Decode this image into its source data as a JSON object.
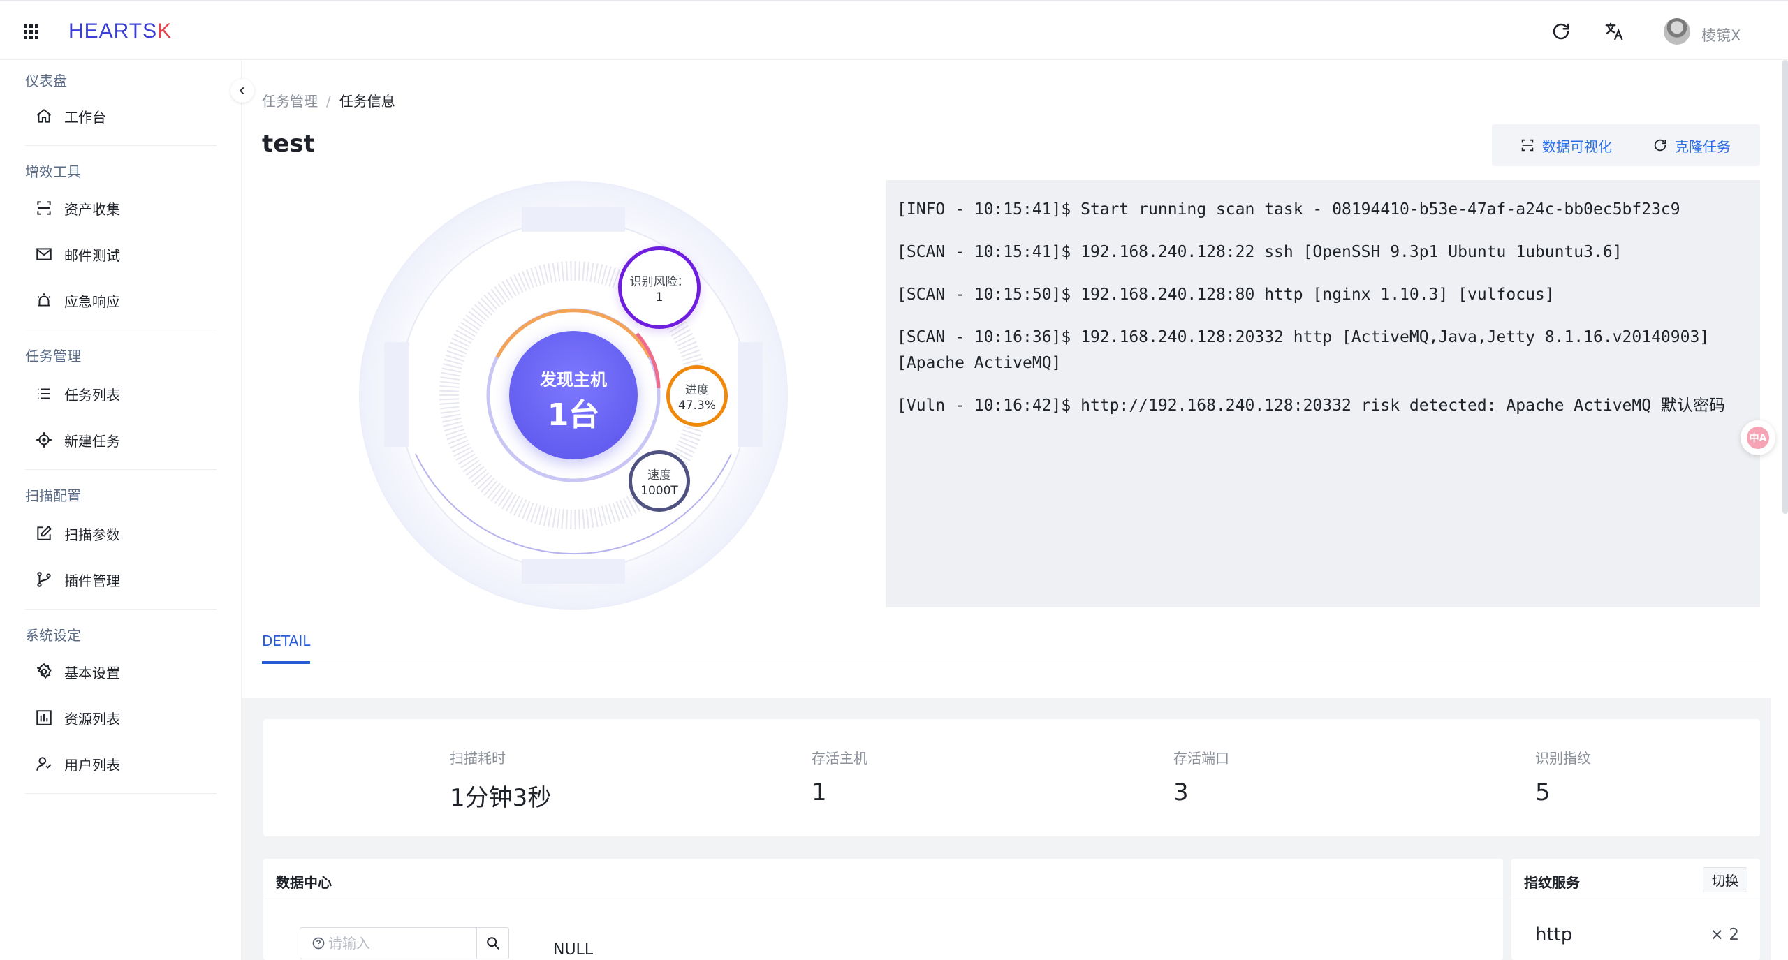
{
  "header": {
    "logo_main": "HEARTS",
    "logo_accent": "K",
    "username": "棱镜X"
  },
  "sidebar": {
    "groups": [
      {
        "label": "仪表盘",
        "items": [
          {
            "label": "工作台",
            "icon": "home-icon"
          }
        ]
      },
      {
        "label": "增效工具",
        "items": [
          {
            "label": "资产收集",
            "icon": "scan-icon"
          },
          {
            "label": "邮件测试",
            "icon": "mail-icon"
          },
          {
            "label": "应急响应",
            "icon": "alarm-icon"
          }
        ]
      },
      {
        "label": "任务管理",
        "items": [
          {
            "label": "任务列表",
            "icon": "list-icon"
          },
          {
            "label": "新建任务",
            "icon": "target-icon"
          }
        ]
      },
      {
        "label": "扫描配置",
        "items": [
          {
            "label": "扫描参数",
            "icon": "edit-icon"
          },
          {
            "label": "插件管理",
            "icon": "branch-icon"
          }
        ]
      },
      {
        "label": "系统设定",
        "items": [
          {
            "label": "基本设置",
            "icon": "gear-icon"
          },
          {
            "label": "资源列表",
            "icon": "resource-icon"
          },
          {
            "label": "用户列表",
            "icon": "users-icon"
          }
        ]
      }
    ]
  },
  "breadcrumb": {
    "parent": "任务管理",
    "sep": "/",
    "current": "任务信息"
  },
  "page": {
    "title": "test"
  },
  "actions": {
    "visualize": "数据可视化",
    "clone": "克隆任务"
  },
  "viz": {
    "center_label": "发现主机",
    "center_value": "1台",
    "risk_label": "识别风险：",
    "risk_value": "1",
    "progress_label": "进度",
    "progress_value": "47.3%",
    "progress": 0.473,
    "speed_label": "速度",
    "speed_value": "1000T"
  },
  "log": [
    "[INFO - 10:15:41]$ Start running scan task - 08194410-b53e-47af-a24c-bb0ec5bf23c9",
    "[SCAN - 10:15:41]$ 192.168.240.128:22 ssh [OpenSSH 9.3p1 Ubuntu 1ubuntu3.6]",
    "[SCAN - 10:15:50]$ 192.168.240.128:80 http [nginx 1.10.3] [vulfocus]",
    "[SCAN - 10:16:36]$ 192.168.240.128:20332 http [ActiveMQ,Java,Jetty 8.1.16.v20140903] [Apache ActiveMQ]",
    "[Vuln - 10:16:42]$ http://192.168.240.128:20332 risk detected: Apache ActiveMQ 默认密码"
  ],
  "tabs": [
    {
      "label": "DETAIL",
      "active": true
    }
  ],
  "stats": [
    {
      "label": "扫描耗时",
      "value": "1分钟3秒"
    },
    {
      "label": "存活主机",
      "value": "1"
    },
    {
      "label": "存活端口",
      "value": "3"
    },
    {
      "label": "识别指纹",
      "value": "5"
    }
  ],
  "data_center": {
    "title": "数据中心",
    "placeholder": "请输入",
    "empty": "NULL"
  },
  "fingerprint": {
    "title": "指纹服务",
    "switch": "切换",
    "item": "http",
    "count": "× 2"
  },
  "float_badge": "中A",
  "colors": {
    "accent": "#2a6ee8",
    "brand": "#5a53ea",
    "risk": "#6f1ee0",
    "progress": "#f0880c",
    "speed": "#4f5280"
  }
}
